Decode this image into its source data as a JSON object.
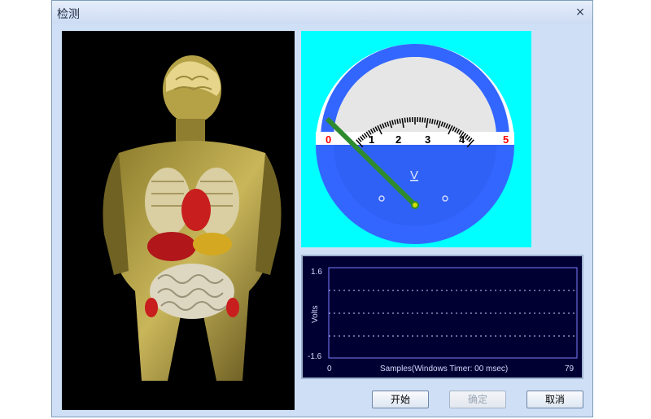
{
  "window": {
    "title": "检测",
    "close_symbol": "×"
  },
  "meter": {
    "scale_labels": [
      "0",
      "1",
      "2",
      "3",
      "4",
      "5"
    ],
    "unit": "V",
    "value": 0,
    "range": [
      0,
      5
    ],
    "colors": {
      "background": "#00ffff",
      "rim": "#3366ff",
      "zero_label": "#ff0000",
      "max_label": "#ff0000",
      "needle": "#2e8b2e",
      "zero_needle": "#ff0000"
    }
  },
  "graph": {
    "y_axis_label": "Volts",
    "y_max": "1.6",
    "y_min": "-1.6",
    "x_min": "0",
    "x_max": "79",
    "x_axis_label": "Samples(Windows Timer:  00 msec)",
    "colors": {
      "background": "#000033",
      "grid": "#d0d0ff",
      "axis": "#7c7cff"
    }
  },
  "buttons": {
    "start_label": "开始",
    "confirm_label": "确定",
    "cancel_label": "取消"
  }
}
